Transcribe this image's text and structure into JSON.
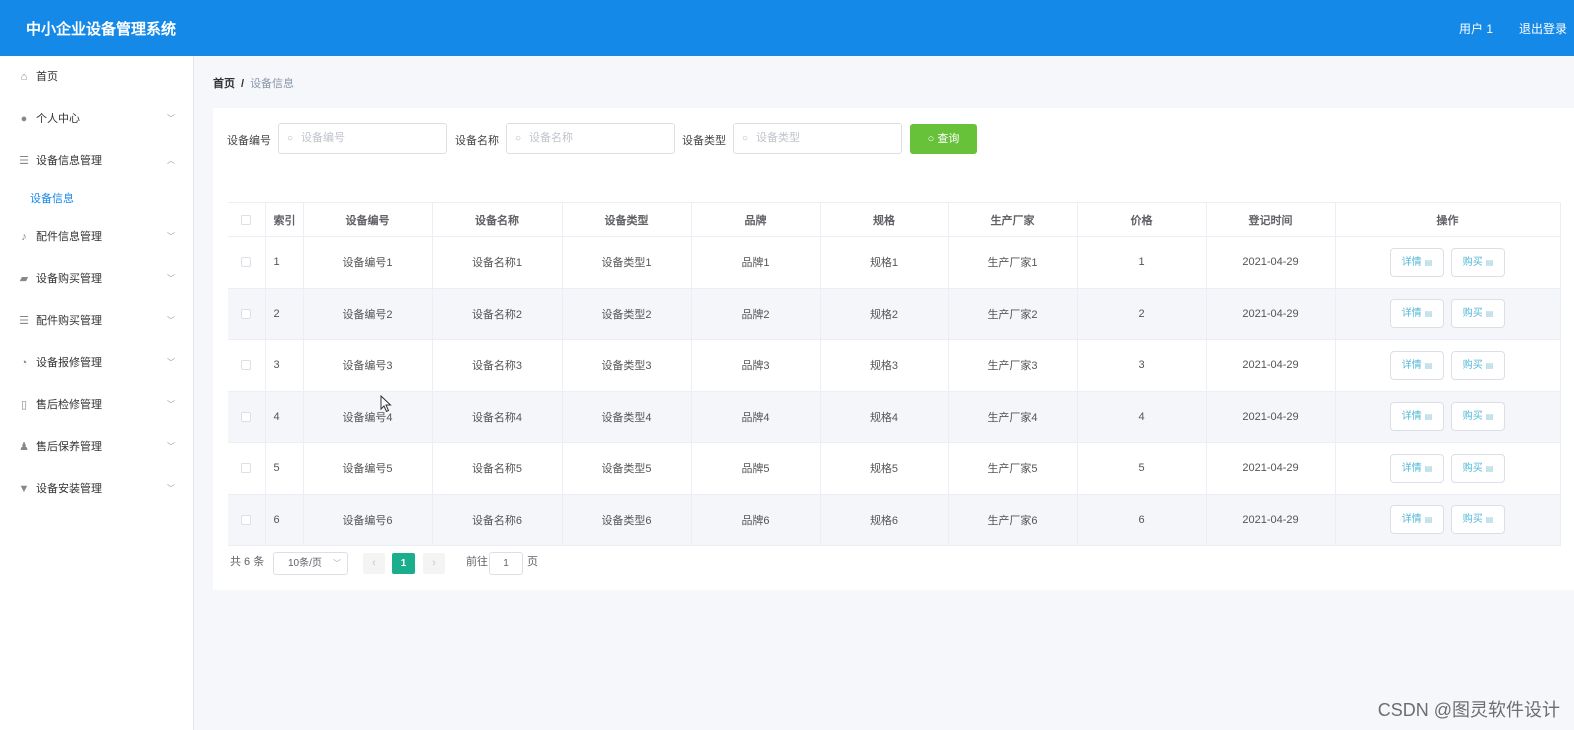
{
  "header": {
    "title": "中小企业设备管理系统",
    "user": "用户 1",
    "logout": "退出登录"
  },
  "sidebar": {
    "items": [
      {
        "label": "首页",
        "icon": "home-icon",
        "expandable": false
      },
      {
        "label": "个人中心",
        "icon": "user-icon",
        "expandable": true
      },
      {
        "label": "设备信息管理",
        "icon": "list-icon",
        "expandable": true,
        "expanded": true,
        "children": [
          "设备信息"
        ]
      },
      {
        "label": "配件信息管理",
        "icon": "mic-icon",
        "expandable": true
      },
      {
        "label": "设备购买管理",
        "icon": "chat-icon",
        "expandable": true
      },
      {
        "label": "配件购买管理",
        "icon": "list-icon",
        "expandable": true
      },
      {
        "label": "设备报修管理",
        "icon": "gauge-icon",
        "expandable": true
      },
      {
        "label": "售后检修管理",
        "icon": "phone-icon",
        "expandable": true
      },
      {
        "label": "售后保养管理",
        "icon": "person-icon",
        "expandable": true
      },
      {
        "label": "设备安装管理",
        "icon": "tools-icon",
        "expandable": true
      }
    ]
  },
  "breadcrumb": {
    "home": "首页",
    "separator": "/",
    "current": "设备信息"
  },
  "search": {
    "fields": [
      {
        "label": "设备编号",
        "placeholder": "设备编号"
      },
      {
        "label": "设备名称",
        "placeholder": "设备名称"
      },
      {
        "label": "设备类型",
        "placeholder": "设备类型"
      }
    ],
    "button": "查询"
  },
  "table": {
    "columns": [
      "索引",
      "设备编号",
      "设备名称",
      "设备类型",
      "品牌",
      "规格",
      "生产厂家",
      "价格",
      "登记时间",
      "操作"
    ],
    "rows": [
      [
        "1",
        "设备编号1",
        "设备名称1",
        "设备类型1",
        "品牌1",
        "规格1",
        "生产厂家1",
        "1",
        "2021-04-29"
      ],
      [
        "2",
        "设备编号2",
        "设备名称2",
        "设备类型2",
        "品牌2",
        "规格2",
        "生产厂家2",
        "2",
        "2021-04-29"
      ],
      [
        "3",
        "设备编号3",
        "设备名称3",
        "设备类型3",
        "品牌3",
        "规格3",
        "生产厂家3",
        "3",
        "2021-04-29"
      ],
      [
        "4",
        "设备编号4",
        "设备名称4",
        "设备类型4",
        "品牌4",
        "规格4",
        "生产厂家4",
        "4",
        "2021-04-29"
      ],
      [
        "5",
        "设备编号5",
        "设备名称5",
        "设备类型5",
        "品牌5",
        "规格5",
        "生产厂家5",
        "5",
        "2021-04-29"
      ],
      [
        "6",
        "设备编号6",
        "设备名称6",
        "设备类型6",
        "品牌6",
        "规格6",
        "生产厂家6",
        "6",
        "2021-04-29"
      ]
    ],
    "actions": [
      "详情",
      "购买"
    ]
  },
  "pagination": {
    "total": "共 6 条",
    "page_size": "10条/页",
    "current_page": "1",
    "goto_label": "前往",
    "goto_value": "1",
    "page_suffix": "页"
  },
  "watermark": "CSDN @图灵软件设计",
  "colors": {
    "header_bg": "#1589e8",
    "query_button": "#67c23a",
    "active_page": "#1aae8d",
    "active_menu_text": "#1589e8"
  }
}
